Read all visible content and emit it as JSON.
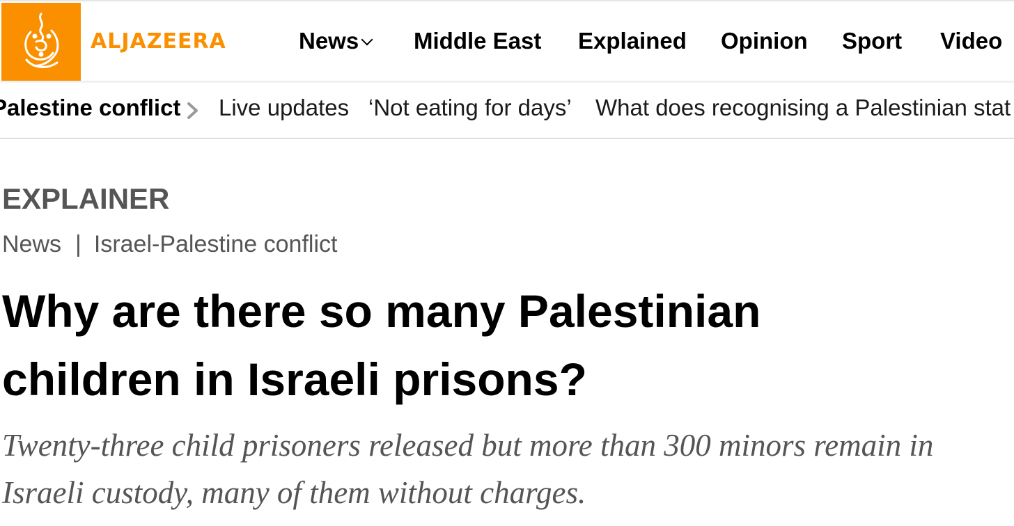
{
  "site": {
    "wordmark": "ALJAZEERA",
    "brand_color": "#fa9000"
  },
  "nav": {
    "items": [
      {
        "label": "News",
        "has_dropdown": true
      },
      {
        "label": "Middle East"
      },
      {
        "label": "Explained"
      },
      {
        "label": "Opinion"
      },
      {
        "label": "Sport"
      },
      {
        "label": "Video"
      }
    ]
  },
  "trending": {
    "topic": "Palestine conflict",
    "links": [
      "Live updates",
      "‘Not eating for days’",
      "What does recognising a Palestinian stat"
    ],
    "arrow_icon": "chevron-right-icon"
  },
  "article": {
    "kicker": "EXPLAINER",
    "breadcrumb": {
      "section": "News",
      "separator": "|",
      "topic": "Israel-Palestine conflict"
    },
    "headline": "Why are there so many Palestinian children in Israeli prisons?",
    "standfirst": "Twenty-three child prisoners released but more than 300 minors remain in Israeli custody, many of them without charges."
  }
}
